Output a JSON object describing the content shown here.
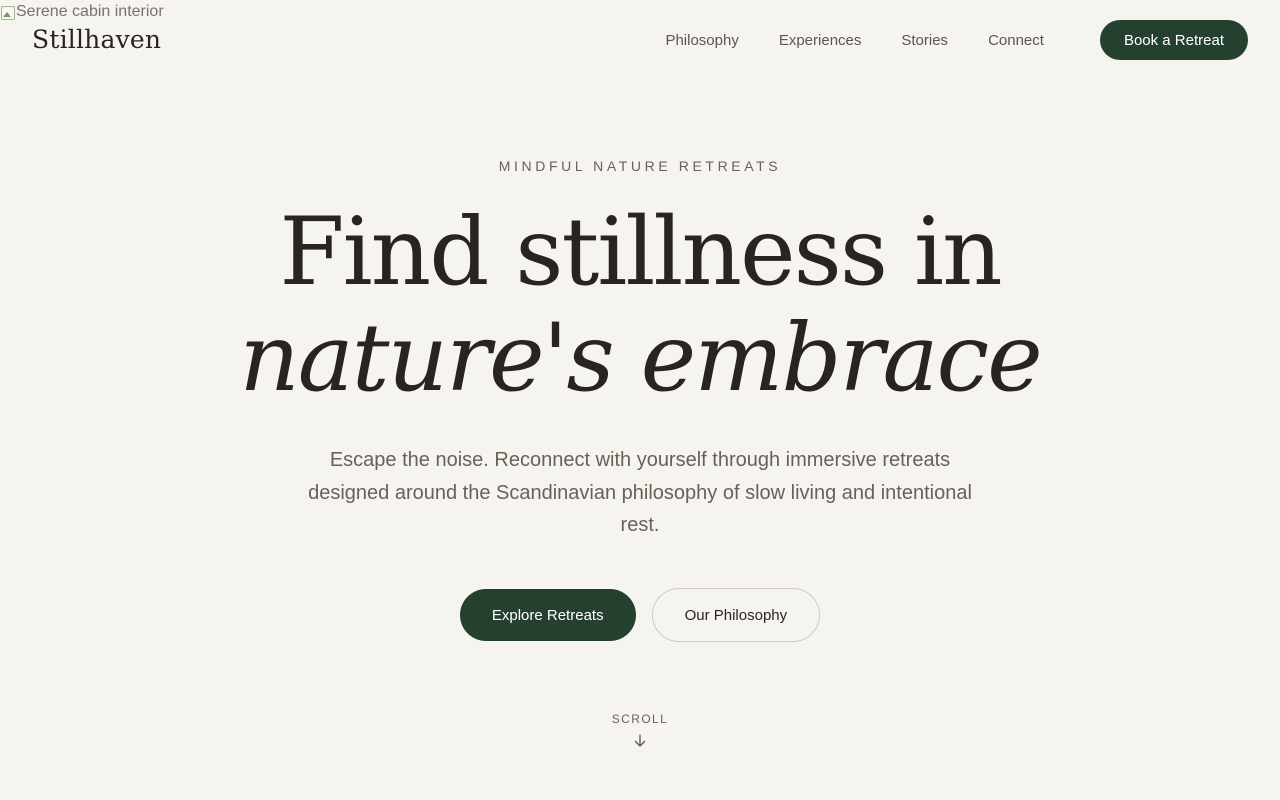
{
  "hero_image": {
    "alt": "Serene cabin interior"
  },
  "brand": {
    "name": "Stillhaven"
  },
  "nav": {
    "links": [
      "Philosophy",
      "Experiences",
      "Stories",
      "Connect"
    ],
    "cta": "Book a Retreat"
  },
  "hero": {
    "eyebrow": "MINDFUL NATURE RETREATS",
    "headline_line1": "Find stillness in",
    "headline_line2": "nature's embrace",
    "lede": "Escape the noise. Reconnect with yourself through immersive retreats designed around the Scandinavian philosophy of slow living and intentional rest.",
    "primary_button": "Explore Retreats",
    "secondary_button": "Our Philosophy",
    "scroll_label": "SCROLL"
  },
  "colors": {
    "background": "#f5f4ef",
    "brand_green": "#26402f",
    "text_dark": "#2a2420",
    "text_muted": "#6b6059"
  },
  "icons": {
    "broken_image": "broken-image-icon",
    "scroll": "arrow-down-icon"
  }
}
